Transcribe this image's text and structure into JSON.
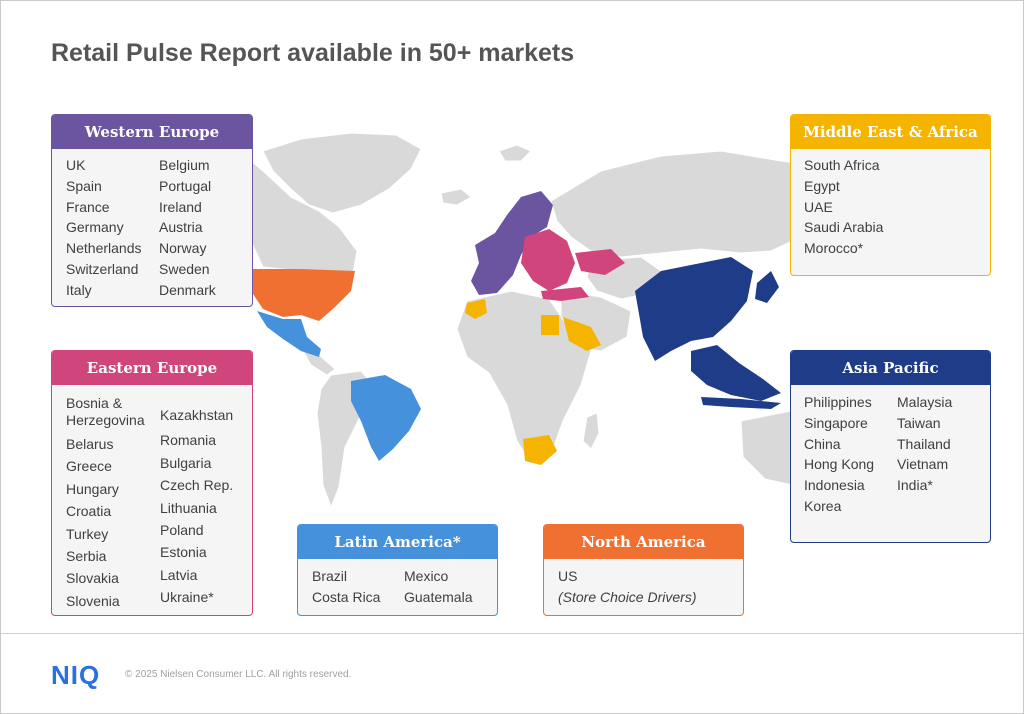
{
  "title": "Retail Pulse Report available in 50+ markets",
  "colors": {
    "western_europe": "#6b55a0",
    "eastern_europe": "#d0457b",
    "latin_america": "#4691dc",
    "north_america": "#ef7030",
    "middle_east_africa": "#f5b400",
    "asia_pacific": "#1f3c88",
    "land": "#d9d9d9"
  },
  "regions": {
    "western_europe": {
      "name": "Western Europe",
      "col1": [
        "UK",
        "Spain",
        "France",
        "Germany",
        "Netherlands",
        "Switzerland",
        "Italy"
      ],
      "col2": [
        "Belgium",
        "Portugal",
        "Ireland",
        "Austria",
        "Norway",
        "Sweden",
        "Denmark"
      ]
    },
    "eastern_europe": {
      "name": "Eastern Europe",
      "col1": [
        "Bosnia & Herzegovina",
        "Belarus",
        "Greece",
        "Hungary",
        "Croatia",
        "Turkey",
        "Serbia",
        "Slovakia",
        "Slovenia"
      ],
      "col2": [
        "Kazakhstan",
        "Romania",
        "Bulgaria",
        "Czech Rep.",
        "Lithuania",
        "Poland",
        "Estonia",
        "Latvia",
        "Ukraine*"
      ]
    },
    "latin_america": {
      "name": "Latin America*",
      "col1": [
        "Brazil",
        "Costa Rica"
      ],
      "col2": [
        "Mexico",
        "Guatemala"
      ]
    },
    "north_america": {
      "name": "North America",
      "col1": [
        "US",
        "(Store Choice Drivers)"
      ]
    },
    "middle_east_africa": {
      "name": "Middle East & Africa",
      "col1": [
        "South Africa",
        "Egypt",
        "UAE",
        "Saudi Arabia",
        "Morocco*"
      ]
    },
    "asia_pacific": {
      "name": "Asia Pacific",
      "col1": [
        "Philippines",
        "Singapore",
        "China",
        "Hong Kong",
        "Indonesia",
        "Korea"
      ],
      "col2": [
        "Malaysia",
        "Taiwan",
        "Thailand",
        "Vietnam",
        "India*"
      ]
    }
  },
  "footer": {
    "logo": "NIQ",
    "copyright": "© 2025 Nielsen Consumer LLC. All rights reserved."
  }
}
